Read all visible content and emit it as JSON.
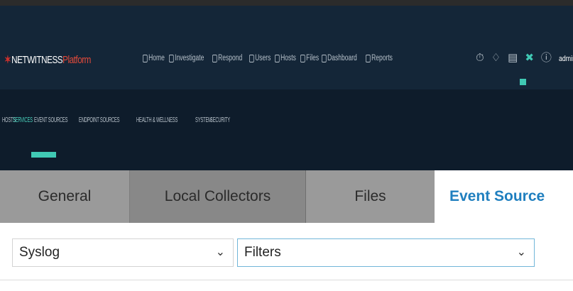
{
  "app": {
    "logo_mark": "✶",
    "logo_name": "NETWITNESS",
    "logo_platform": "Platform"
  },
  "main_nav": [
    {
      "label": "Home",
      "icon": "home-icon"
    },
    {
      "label": "Investigate",
      "icon": "investigate-icon"
    },
    {
      "label": "Respond",
      "icon": "respond-icon"
    },
    {
      "label": "Users",
      "icon": "users-icon"
    },
    {
      "label": "Hosts",
      "icon": "hosts-icon"
    },
    {
      "label": "Files",
      "icon": "files-icon"
    },
    {
      "label": "Dashboard",
      "icon": "dashboard-icon"
    },
    {
      "label": "Reports",
      "icon": "reports-icon"
    }
  ],
  "right_tools": {
    "user": "admin ∨",
    "icons": [
      "timer-icon",
      "bell-icon",
      "clipboard-icon",
      "admin-tools-icon",
      "help-icon"
    ]
  },
  "sub_nav": [
    {
      "label": "HOSTS"
    },
    {
      "label": "SERVICES"
    },
    {
      "label": "EVENT SOURCES"
    },
    {
      "label": "ENDPOINT SOURCES"
    },
    {
      "label": "HEALTH & WELLNESS"
    },
    {
      "label": "SYSTEM"
    },
    {
      "label": "SECURITY"
    }
  ],
  "tabs": [
    {
      "label": "General"
    },
    {
      "label": "Local Collectors"
    },
    {
      "label": "Files"
    },
    {
      "label": "Event Source"
    }
  ],
  "filters": {
    "source_type": "Syslog",
    "filter": "Filters"
  },
  "colors": {
    "accent": "#40c9b4",
    "active_tab_text": "#1f7fbf",
    "header_bg": "#142638",
    "subnav_bg": "#0e1c2b"
  }
}
